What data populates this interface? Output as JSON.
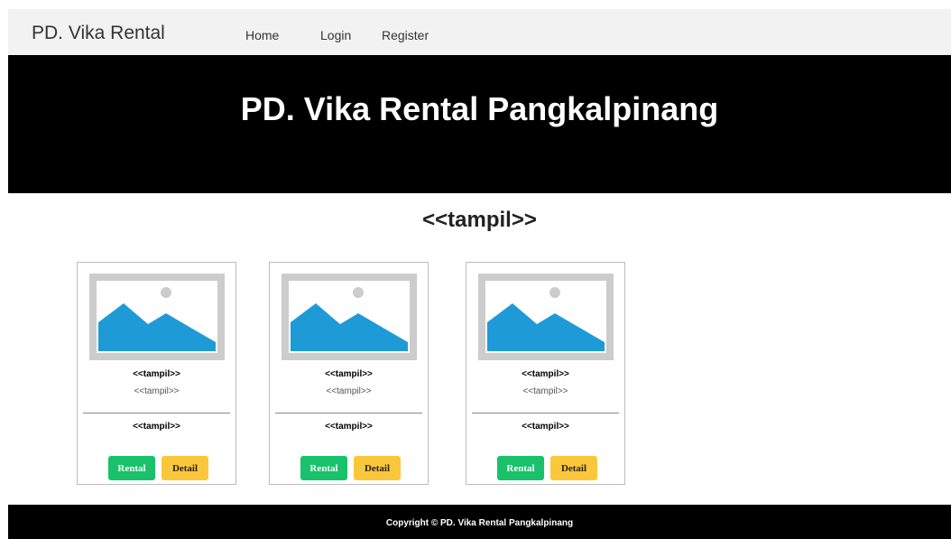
{
  "navbar": {
    "brand": "PD. Vika Rental",
    "links": [
      "Home",
      "Login",
      "Register"
    ]
  },
  "hero": {
    "title": "PD. Vika Rental Pangkalpinang"
  },
  "section": {
    "title": "<<tampil>>"
  },
  "cards": [
    {
      "image_icon": "image-placeholder-icon",
      "name": "<<tampil>>",
      "subtitle": "<<tampil>>",
      "price": "<<tampil>>",
      "rental_label": "Rental",
      "detail_label": "Detail"
    },
    {
      "image_icon": "image-placeholder-icon",
      "name": "<<tampil>>",
      "subtitle": "<<tampil>>",
      "price": "<<tampil>>",
      "rental_label": "Rental",
      "detail_label": "Detail"
    },
    {
      "image_icon": "image-placeholder-icon",
      "name": "<<tampil>>",
      "subtitle": "<<tampil>>",
      "price": "<<tampil>>",
      "rental_label": "Rental",
      "detail_label": "Detail"
    }
  ],
  "footer": {
    "text": "Copyright © PD. Vika Rental Pangkalpinang"
  },
  "colors": {
    "rental_button": "#19c26a",
    "detail_button": "#fbc73a",
    "image_sky": "#1e9bd7",
    "hero_bg": "#000000"
  }
}
